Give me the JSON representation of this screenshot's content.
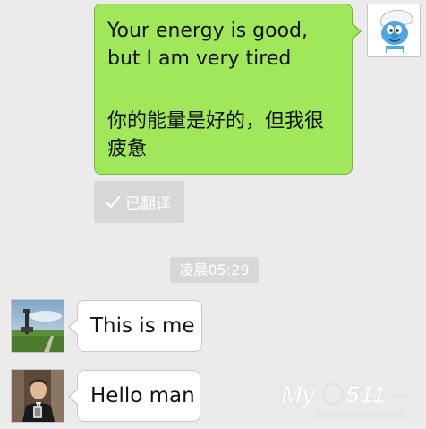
{
  "messages": {
    "outgoing": {
      "text": "Your energy is good, but I am very tired",
      "translation": "你的能量是好的，但我很疲惫",
      "translated_label": "已翻译",
      "bubble_color": "#a0e75a"
    },
    "timestamp": "凌晨05:29",
    "incoming": [
      {
        "text": "This is me"
      },
      {
        "text": "Hello man"
      }
    ]
  },
  "icons": {
    "check": "check-icon",
    "self_avatar": "smurf-avatar",
    "peer_avatar_1": "landscape-tower-avatar",
    "peer_avatar_2": "person-selfie-avatar",
    "watermark": "myo511-watermark-logo"
  },
  "colors": {
    "background": "#ebebeb",
    "badge": "#d7d7d7",
    "incoming_bubble": "#ffffff"
  }
}
